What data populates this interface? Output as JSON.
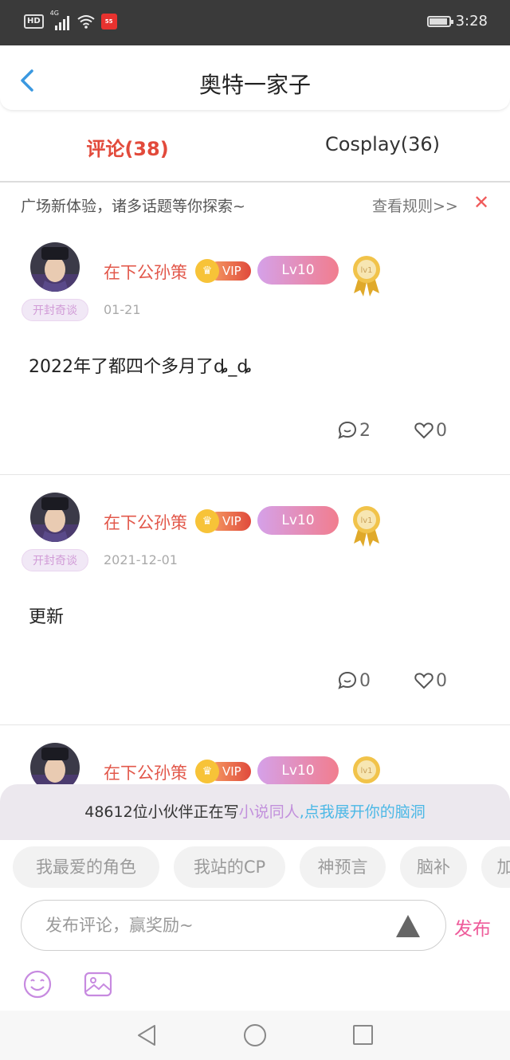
{
  "status_bar": {
    "hd": "HD",
    "network": "4G",
    "app_badge": "55",
    "time": "3:28"
  },
  "header": {
    "title": "奥特一家子"
  },
  "tabs": [
    {
      "label": "评论(38)",
      "active": true
    },
    {
      "label": "Cosplay(36)",
      "active": false
    }
  ],
  "notice": {
    "text": "广场新体验，诸多话题等你探索~",
    "rules_link": "查看规则>>",
    "close": "✕"
  },
  "posts": [
    {
      "username": "在下公孙策",
      "vip": "VIP",
      "level": "Lv10",
      "medal": "lv1",
      "frame_badge": "开封奇谈",
      "date": "01-21",
      "content": "2022年了都四个多月了ȡ_ȡ",
      "comments": "2",
      "likes": "0"
    },
    {
      "username": "在下公孙策",
      "vip": "VIP",
      "level": "Lv10",
      "medal": "lv1",
      "frame_badge": "开封奇谈",
      "date": "2021-12-01",
      "content": "更新",
      "comments": "0",
      "likes": "0"
    },
    {
      "username": "在下公孙策",
      "vip": "VIP",
      "level": "Lv10",
      "medal": "lv1"
    }
  ],
  "promo": {
    "prefix": "48612位小伙伴正在写",
    "highlight1": "小说同人",
    "highlight2": ",点我展开你的脑洞"
  },
  "chips": [
    "我最爱的角色",
    "我站的CP",
    "神预言",
    "脑补",
    "加"
  ],
  "composer": {
    "placeholder": "发布评论，赢奖励~",
    "publish": "发布"
  },
  "colors": {
    "accent_red": "#e2584b",
    "tab_active": "#e24a3b",
    "publish_pink": "#ee5b9a",
    "promo_pink": "#c290dc",
    "promo_blue": "#4cb8e6",
    "level_gradient": [
      "#d5a1e9",
      "#f17d8e"
    ]
  },
  "icons": {
    "back": "chevron-left-icon",
    "comment": "speech-bubble-icon",
    "like": "heart-icon",
    "emoji": "smiley-icon",
    "image": "picture-icon",
    "send": "triangle-up-icon"
  }
}
